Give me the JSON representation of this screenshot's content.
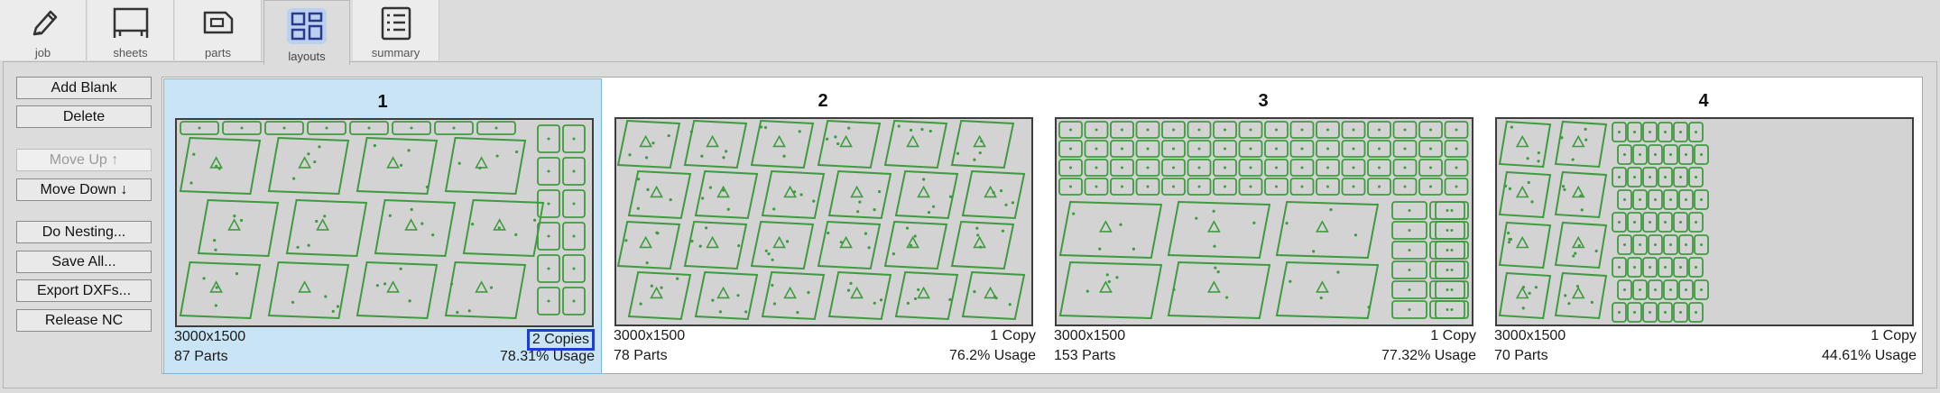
{
  "tabs": [
    {
      "label": "job",
      "icon": "pencil-icon"
    },
    {
      "label": "sheets",
      "icon": "sheet-icon"
    },
    {
      "label": "parts",
      "icon": "part-icon"
    },
    {
      "label": "layouts",
      "icon": "layouts-icon"
    },
    {
      "label": "summary",
      "icon": "summary-icon"
    }
  ],
  "active_tab": "layouts",
  "buttons": {
    "add_blank": "Add Blank",
    "delete": "Delete",
    "move_up": "Move Up ↑",
    "move_down": "Move Down ↓",
    "do_nesting": "Do Nesting...",
    "save_all": "Save All...",
    "export_dxfs": "Export DXFs...",
    "release_nc": "Release NC"
  },
  "layouts": [
    {
      "number": "1",
      "size": "3000x1500",
      "copies": "2 Copies",
      "parts": "87 Parts",
      "usage": "78.31% Usage",
      "usage_fraction": 0.7831,
      "selected": true
    },
    {
      "number": "2",
      "size": "3000x1500",
      "copies": "1 Copy",
      "parts": "78 Parts",
      "usage": "76.2% Usage",
      "usage_fraction": 0.762,
      "selected": false
    },
    {
      "number": "3",
      "size": "3000x1500",
      "copies": "1 Copy",
      "parts": "153 Parts",
      "usage": "77.32% Usage",
      "usage_fraction": 0.7732,
      "selected": false
    },
    {
      "number": "4",
      "size": "3000x1500",
      "copies": "1 Copy",
      "parts": "70 Parts",
      "usage": "44.61% Usage",
      "usage_fraction": 0.4461,
      "selected": false
    }
  ],
  "colors": {
    "part_stroke": "#3f9b3f",
    "sheet_fill": "#d3d3d3",
    "selected_bg": "#c9e4f5",
    "active_tab_highlight": "#bcd0ef",
    "copies_box": "#1d3fd0"
  }
}
